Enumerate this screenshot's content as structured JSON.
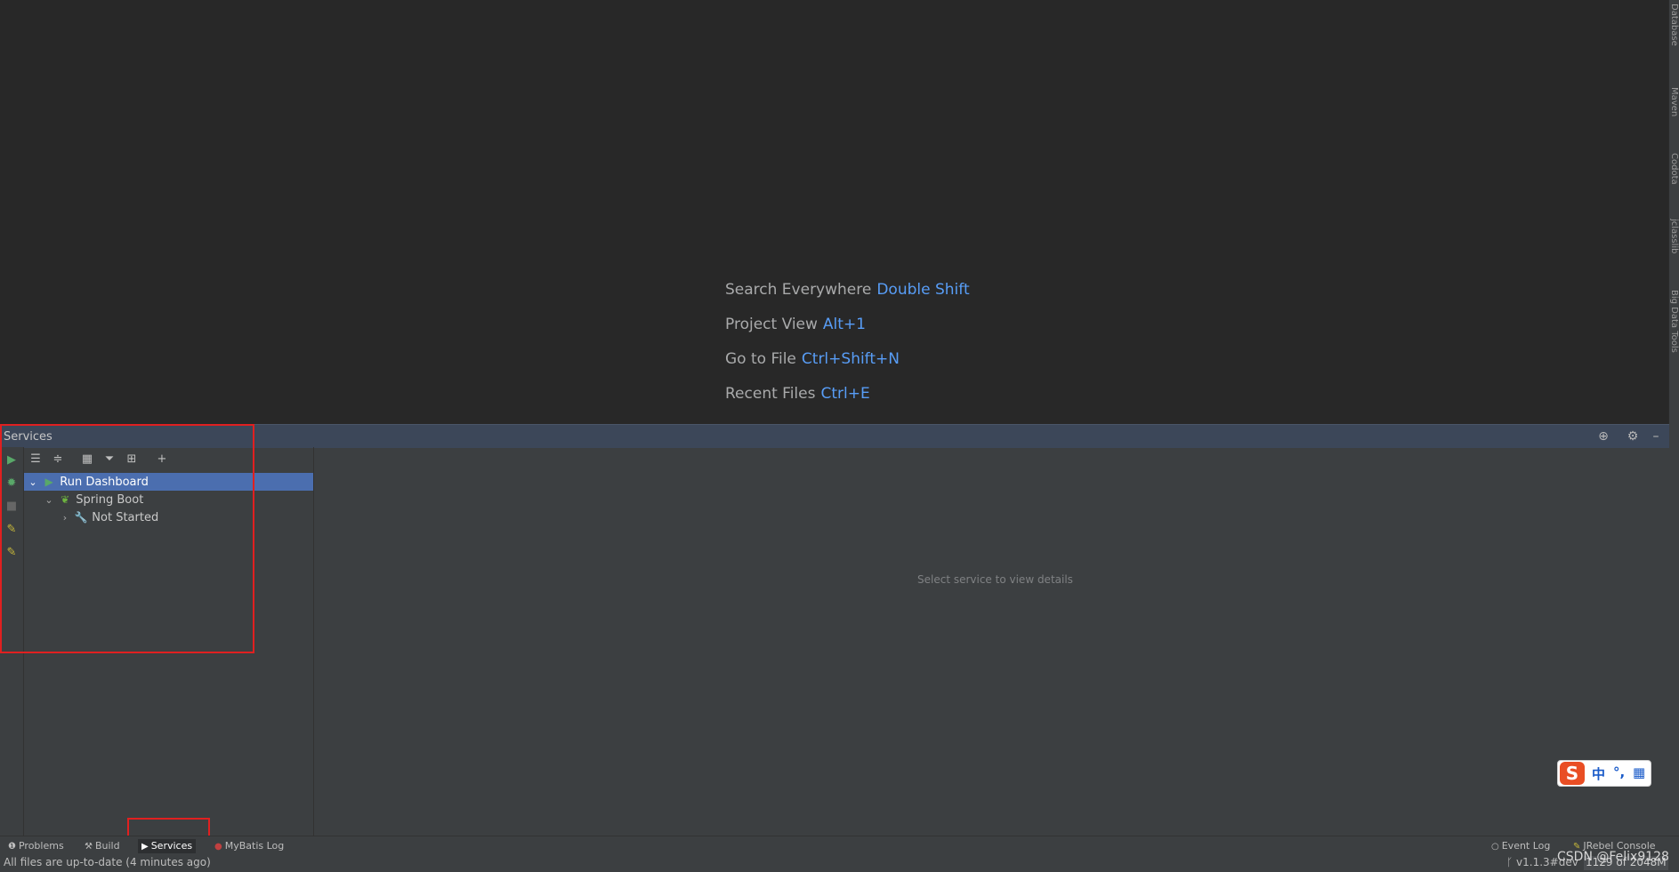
{
  "editor": {
    "hints": [
      {
        "label": "Search Everywhere",
        "key": "Double Shift"
      },
      {
        "label": "Project View",
        "key": "Alt+1"
      },
      {
        "label": "Go to File",
        "key": "Ctrl+Shift+N"
      },
      {
        "label": "Recent Files",
        "key": "Ctrl+E"
      }
    ]
  },
  "right_strip": {
    "items": [
      "Database",
      "Maven",
      "Codota",
      "jclasslib",
      "Big Data Tools"
    ]
  },
  "services": {
    "title": "Services",
    "tree": [
      {
        "label": "Run Dashboard",
        "icon": "run-icon",
        "expanded": true,
        "selected": true
      },
      {
        "label": "Spring Boot",
        "icon": "spring-boot-icon",
        "expanded": true,
        "selected": false
      },
      {
        "label": "Not Started",
        "icon": "wrench-icon",
        "expanded": false,
        "selected": false
      }
    ],
    "detail_placeholder": "Select service to view details"
  },
  "ime": {
    "logo": "S",
    "lang": "中",
    "punct": "°,",
    "grid": "▦"
  },
  "tool_tabs": {
    "problems": "Problems",
    "build": "Build",
    "services": "Services",
    "mybatis_log": "MyBatis Log",
    "event_log": "Event Log",
    "jrebel_console": "JRebel Console"
  },
  "status_bar": {
    "message": "All files are up-to-date (4 minutes ago)",
    "branch": "v1.1.3#dev",
    "memory": "1129 of 2048M"
  },
  "watermark": "CSDN @Felix9128",
  "colors": {
    "accent": "#4b6eaf",
    "key": "#589df6",
    "highlight": "#e02020",
    "run": "#59a869"
  }
}
